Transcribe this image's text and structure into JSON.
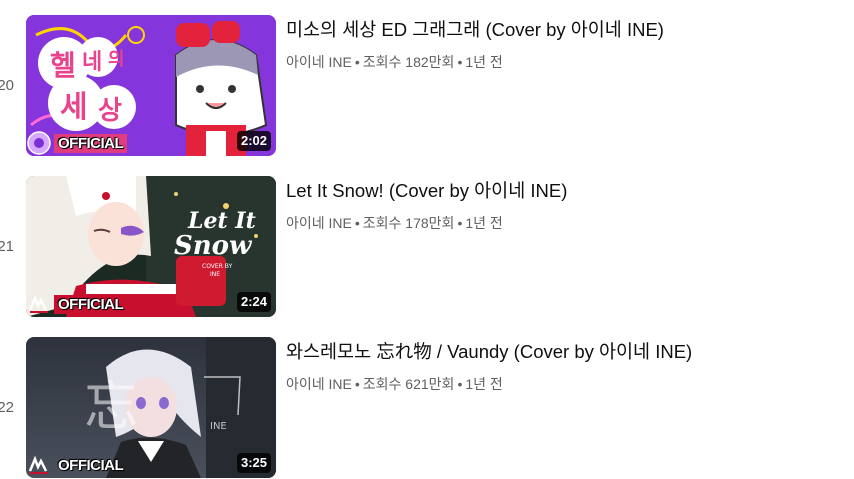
{
  "videos": [
    {
      "index": "20",
      "title": "미소의 세상 ED 그래그래 (Cover by 아이네 INE)",
      "channel": "아이네 INE",
      "views": "조회수 182만회",
      "age": "1년 전",
      "duration": "2:02",
      "badge": "OFFICIAL",
      "thumb_text": [
        "헬",
        "네",
        "의",
        "세",
        "상"
      ],
      "colors": {
        "bg": "#7b2fd6",
        "accent": "#ffd400"
      }
    },
    {
      "index": "21",
      "title": "Let It Snow! (Cover by 아이네 INE)",
      "channel": "아이네 INE",
      "views": "조회수 178만회",
      "age": "1년 전",
      "duration": "2:24",
      "badge": "OFFICIAL",
      "thumb_text": [
        "Let It",
        "Snow",
        "COVER BY",
        "INE"
      ],
      "colors": {
        "bg": "#1c2a24",
        "accent": "#c8102e"
      }
    },
    {
      "index": "22",
      "title": "와스레모노 忘れ物 / Vaundy (Cover by 아이네 INE)",
      "channel": "아이네 INE",
      "views": "조회수 621만회",
      "age": "1년 전",
      "duration": "3:25",
      "badge": "OFFICIAL",
      "thumb_text": [
        "忘",
        "INE"
      ],
      "colors": {
        "bg": "#3a3f4a",
        "accent": "#9aa4b8"
      }
    }
  ],
  "separator": "•"
}
